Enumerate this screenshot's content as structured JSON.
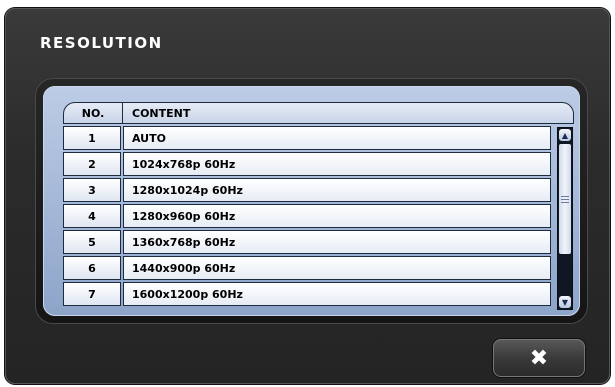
{
  "dialog": {
    "title": "RESOLUTION",
    "close_icon": "✖"
  },
  "table": {
    "columns": [
      "NO.",
      "CONTENT"
    ],
    "rows": [
      {
        "no": "1",
        "content": "AUTO"
      },
      {
        "no": "2",
        "content": "1024x768p 60Hz"
      },
      {
        "no": "3",
        "content": "1280x1024p 60Hz"
      },
      {
        "no": "4",
        "content": "1280x960p 60Hz"
      },
      {
        "no": "5",
        "content": "1360x768p 60Hz"
      },
      {
        "no": "6",
        "content": "1440x900p 60Hz"
      },
      {
        "no": "7",
        "content": "1600x1200p 60Hz"
      }
    ]
  },
  "scrollbar": {
    "up_icon": "▲",
    "down_icon": "▼"
  },
  "colors": {
    "dialog_bg": "#2b2b2b",
    "panel_bg": "#a9bbd9",
    "row_bg": "#ffffff",
    "border": "#1e2a3e",
    "scroll_track": "#0f1624"
  }
}
